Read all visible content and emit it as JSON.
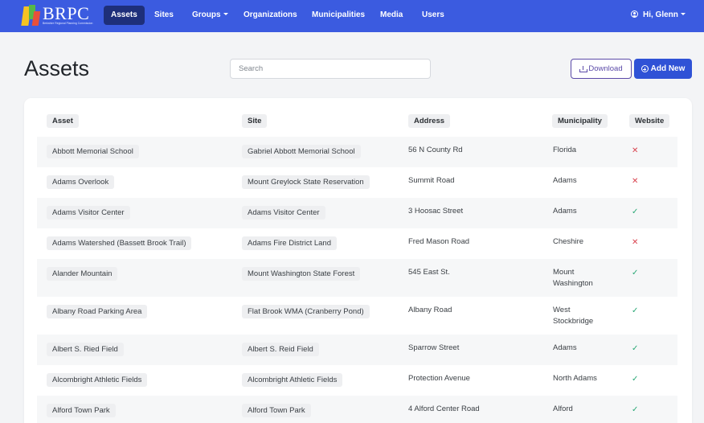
{
  "app": {
    "logo_text": "BRPC",
    "logo_subtitle": "Berkshire Regional Planning Commission"
  },
  "nav": {
    "items": [
      {
        "label": "Assets",
        "active": true
      },
      {
        "label": "Sites"
      },
      {
        "label": "Groups",
        "dropdown": true
      },
      {
        "label": "Organizations"
      },
      {
        "label": "Municipalities"
      },
      {
        "label": "Media"
      },
      {
        "label": "Users"
      }
    ],
    "user_label": "Hi, Glenn"
  },
  "page": {
    "title": "Assets",
    "search_placeholder": "Search",
    "download_label": "Download",
    "add_new_label": "Add New"
  },
  "table": {
    "headers": {
      "asset": "Asset",
      "site": "Site",
      "address": "Address",
      "municipality": "Municipality",
      "website": "Website"
    },
    "rows": [
      {
        "asset": "Abbott Memorial School",
        "site": "Gabriel Abbott Memorial School",
        "address": "56 N County Rd",
        "muni_line1": "Florida",
        "muni_line2": "",
        "website": false
      },
      {
        "asset": "Adams Overlook",
        "site": "Mount Greylock State Reservation",
        "address": "Summit Road",
        "muni_line1": "Adams",
        "muni_line2": "",
        "website": false
      },
      {
        "asset": "Adams Visitor Center",
        "site": "Adams Visitor Center",
        "address": "3 Hoosac Street",
        "muni_line1": "Adams",
        "muni_line2": "",
        "website": true
      },
      {
        "asset": "Adams Watershed (Bassett Brook Trail)",
        "site": "Adams Fire District Land",
        "address": "Fred Mason Road",
        "muni_line1": "Cheshire",
        "muni_line2": "",
        "website": false
      },
      {
        "asset": "Alander Mountain",
        "site": "Mount Washington State Forest",
        "address": "545 East St.",
        "muni_line1": "Mount",
        "muni_line2": "Washington",
        "website": true
      },
      {
        "asset": "Albany Road Parking Area",
        "site": "Flat Brook WMA (Cranberry Pond)",
        "address": "Albany Road",
        "muni_line1": "West",
        "muni_line2": "Stockbridge",
        "website": true
      },
      {
        "asset": "Albert S. Ried Field",
        "site": "Albert S. Reid Field",
        "address": "Sparrow Street",
        "muni_line1": "Adams",
        "muni_line2": "",
        "website": true
      },
      {
        "asset": "Alcombright Athletic Fields",
        "site": "Alcombright Athletic Fields",
        "address": "Protection Avenue",
        "muni_line1": "North Adams",
        "muni_line2": "",
        "website": true
      },
      {
        "asset": "Alford Town Park",
        "site": "Alford Town Park",
        "address": "4 Alford Center Road",
        "muni_line1": "Alford",
        "muni_line2": "",
        "website": true
      }
    ],
    "mark_yes": "✓",
    "mark_no": "✕"
  },
  "colors": {
    "navbar": "#3b5be0",
    "nav_active": "#1e2f7a",
    "primary_button": "#2f52d6",
    "download_outline": "#5b4aa8",
    "check_green": "#2aa876",
    "cross_red": "#d9434f"
  },
  "icons": {
    "user": "user-circle-icon",
    "download": "download-icon",
    "add": "plus-circle-icon",
    "yes": "check-icon",
    "no": "cross-icon"
  }
}
